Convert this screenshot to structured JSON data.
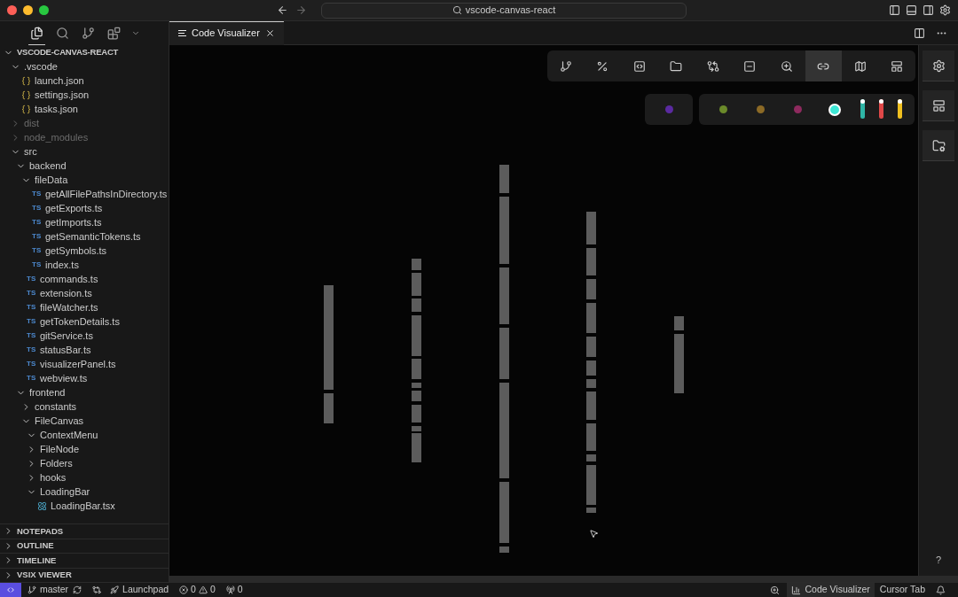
{
  "window": {
    "title": "vscode-canvas-react"
  },
  "views": [
    {
      "kind": "files",
      "selected": true
    },
    {
      "kind": "search",
      "selected": false
    },
    {
      "kind": "branch",
      "selected": false
    },
    {
      "kind": "extensions",
      "selected": false
    }
  ],
  "explorer": {
    "title": "VSCODE-CANVAS-REACT",
    "expanded": true,
    "tree": [
      {
        "name": ".vscode",
        "kind": "folder",
        "expanded": true,
        "dimmed": false,
        "children": [
          {
            "name": "launch.json",
            "kind": "json"
          },
          {
            "name": "settings.json",
            "kind": "json"
          },
          {
            "name": "tasks.json",
            "kind": "json"
          }
        ]
      },
      {
        "name": "dist",
        "kind": "folder",
        "expanded": false,
        "dimmed": true
      },
      {
        "name": "node_modules",
        "kind": "folder",
        "expanded": false,
        "dimmed": true
      },
      {
        "name": "src",
        "kind": "folder",
        "expanded": true,
        "dimmed": false,
        "children": [
          {
            "name": "backend",
            "kind": "folder",
            "expanded": true,
            "children": [
              {
                "name": "fileData",
                "kind": "folder",
                "expanded": true,
                "children": [
                  {
                    "name": "getAllFilePathsInDirectory.ts",
                    "kind": "ts",
                    "badge": "TS"
                  },
                  {
                    "name": "getExports.ts",
                    "kind": "ts",
                    "badge": "TS"
                  },
                  {
                    "name": "getImports.ts",
                    "kind": "ts",
                    "badge": "TS"
                  },
                  {
                    "name": "getSemanticTokens.ts",
                    "kind": "ts",
                    "badge": "TS"
                  },
                  {
                    "name": "getSymbols.ts",
                    "kind": "ts",
                    "badge": "TS"
                  },
                  {
                    "name": "index.ts",
                    "kind": "ts",
                    "badge": "TS"
                  }
                ]
              },
              {
                "name": "commands.ts",
                "kind": "ts",
                "badge": "TS"
              },
              {
                "name": "extension.ts",
                "kind": "ts",
                "badge": "TS"
              },
              {
                "name": "fileWatcher.ts",
                "kind": "ts",
                "badge": "TS"
              },
              {
                "name": "getTokenDetails.ts",
                "kind": "ts",
                "badge": "TS"
              },
              {
                "name": "gitService.ts",
                "kind": "ts",
                "badge": "TS"
              },
              {
                "name": "statusBar.ts",
                "kind": "ts",
                "badge": "TS"
              },
              {
                "name": "visualizerPanel.ts",
                "kind": "ts",
                "badge": "TS"
              },
              {
                "name": "webview.ts",
                "kind": "ts",
                "badge": "TS"
              }
            ]
          },
          {
            "name": "frontend",
            "kind": "folder",
            "expanded": true,
            "children": [
              {
                "name": "constants",
                "kind": "folder",
                "expanded": false
              },
              {
                "name": "FileCanvas",
                "kind": "folder",
                "expanded": true,
                "children": [
                  {
                    "name": "ContextMenu",
                    "kind": "folder",
                    "expanded": true
                  },
                  {
                    "name": "FileNode",
                    "kind": "folder",
                    "expanded": false
                  },
                  {
                    "name": "Folders",
                    "kind": "folder",
                    "expanded": false
                  },
                  {
                    "name": "hooks",
                    "kind": "folder",
                    "expanded": false
                  },
                  {
                    "name": "LoadingBar",
                    "kind": "folder",
                    "expanded": true,
                    "children": [
                      {
                        "name": "LoadingBar.tsx",
                        "kind": "tsx"
                      }
                    ]
                  }
                ]
              }
            ]
          }
        ]
      }
    ]
  },
  "sections": [
    {
      "title": "NOTEPADS",
      "expanded": false
    },
    {
      "title": "OUTLINE",
      "expanded": false
    },
    {
      "title": "TIMELINE",
      "expanded": false
    },
    {
      "title": "VSIX VIEWER",
      "expanded": false
    }
  ],
  "editor_tabs": [
    {
      "label": "Code Visualizer",
      "selected": true
    }
  ],
  "toolbar": [
    {
      "kind": "branch",
      "selected": false
    },
    {
      "kind": "percent",
      "selected": false
    },
    {
      "kind": "braces",
      "selected": false
    },
    {
      "kind": "folder",
      "selected": false
    },
    {
      "kind": "compare",
      "selected": false
    },
    {
      "kind": "minus",
      "selected": false
    },
    {
      "kind": "zoom",
      "selected": false
    },
    {
      "kind": "link",
      "selected": true
    },
    {
      "kind": "map",
      "selected": false
    },
    {
      "kind": "layout",
      "selected": false
    }
  ],
  "palette": [
    [
      {
        "kind": "dot",
        "color": "#5a2aa0",
        "selected": false
      }
    ],
    [
      {
        "kind": "dot",
        "color": "#6b8a2a",
        "selected": false
      },
      {
        "kind": "dot",
        "color": "#8c6a26",
        "selected": false
      },
      {
        "kind": "dot",
        "color": "#8e2a5e",
        "selected": false
      },
      {
        "kind": "dot",
        "color": "#3ee8d6",
        "selected": true
      },
      {
        "kind": "pill",
        "color": "#2fb5a6",
        "selected": false
      },
      {
        "kind": "pill",
        "color": "#e04848",
        "selected": false
      },
      {
        "kind": "pill",
        "color": "#f0c020",
        "selected": false
      }
    ]
  ],
  "side_tools": [
    {
      "kind": "settings"
    },
    {
      "kind": "layout"
    },
    {
      "kind": "folder-settings"
    }
  ],
  "help": "?",
  "status_bar": {
    "branch": "master",
    "launchpad": "Launchpad",
    "errors": "0",
    "warnings": "0",
    "ports": "0",
    "right": [
      {
        "kind": "zoom"
      },
      {
        "kind": "chart",
        "label": "Code Visualizer",
        "selected": true
      },
      {
        "kind": "text",
        "label": "Cursor Tab",
        "selected": false
      },
      {
        "kind": "bell"
      }
    ]
  }
}
